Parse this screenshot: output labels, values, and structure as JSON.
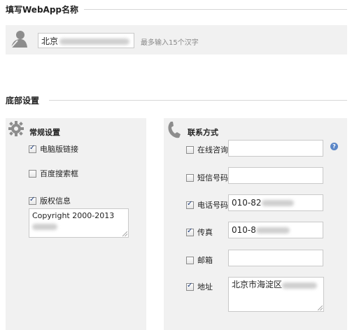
{
  "webapp_name": {
    "section_title": "填写WebApp名称",
    "input_value": "北京",
    "hint": "最多输入15个汉字"
  },
  "footer_settings": {
    "section_title": "底部设置",
    "general": {
      "title": "常规设置",
      "options": [
        {
          "label": "电脑版链接",
          "checked": true
        },
        {
          "label": "百度搜索框",
          "checked": false
        },
        {
          "label": "版权信息",
          "checked": true
        }
      ],
      "copyright_text": "Copyright 2000-2013"
    },
    "contact": {
      "title": "联系方式",
      "fields": [
        {
          "label": "在线咨询",
          "checked": false,
          "value": ""
        },
        {
          "label": "短信号码",
          "checked": false,
          "value": ""
        },
        {
          "label": "电话号码",
          "checked": true,
          "value": "010-82"
        },
        {
          "label": "传真",
          "checked": true,
          "value": "010-8"
        },
        {
          "label": "邮箱",
          "checked": false,
          "value": ""
        },
        {
          "label": "地址",
          "checked": true,
          "value": "北京市海淀区"
        }
      ],
      "help_symbol": "?"
    }
  },
  "icons": {
    "user": "user-silhouette-icon",
    "gear": "gear-icon",
    "phone": "phone-handset-icon",
    "help": "help-icon"
  },
  "colors": {
    "panel_bg": "#f1f1f1",
    "help_blue": "#5b86c7",
    "check_color": "#1b3a7a"
  }
}
